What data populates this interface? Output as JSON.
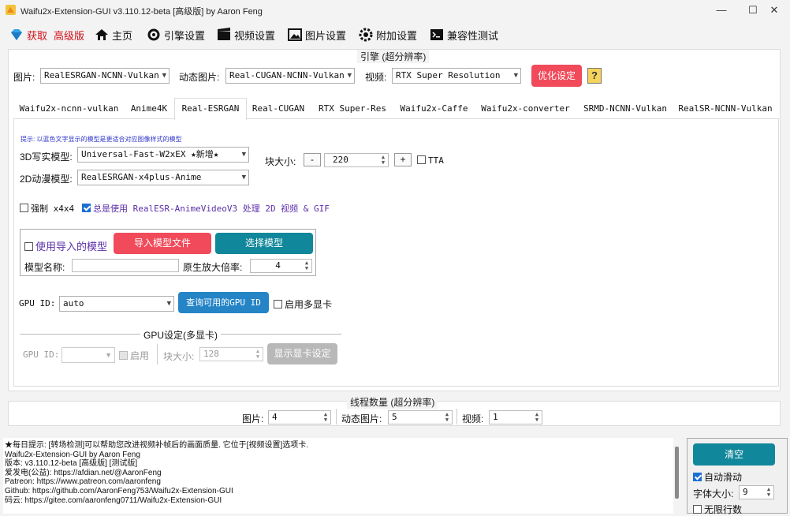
{
  "window": {
    "title": "Waifu2x-Extension-GUI v3.110.12-beta [高级版] by Aaron Feng"
  },
  "menu": {
    "get_label": "获取",
    "premium_label": "高级版",
    "home": "主页",
    "engine": "引擎设置",
    "video": "视频设置",
    "image": "图片设置",
    "extra": "附加设置",
    "compat": "兼容性测试"
  },
  "engine_group": {
    "title": "引擎 (超分辨率)",
    "image_label": "图片:",
    "image_engine": "RealESRGAN-NCNN-Vulkan",
    "gif_label": "动态图片:",
    "gif_engine": "Real-CUGAN-NCNN-Vulkan",
    "video_label": "视频:",
    "video_engine": "RTX Super Resolution",
    "optimize_button": "优化设定",
    "help_icon": "?"
  },
  "tabs": [
    "Waifu2x-ncnn-vulkan",
    "Anime4K",
    "Real-ESRGAN",
    "Real-CUGAN",
    "RTX Super-Res",
    "Waifu2x-Caffe",
    "Waifu2x-converter",
    "SRMD-NCNN-Vulkan",
    "RealSR-NCNN-Vulkan"
  ],
  "realesrgan": {
    "hint": "提示: 以蓝色文字显示的模型是更适合对应图像样式的模型",
    "model3d_label": "3D写实模型:",
    "model3d_value": "Universal-Fast-W2xEX ★新增★",
    "model2d_label": "2D动漫模型:",
    "model2d_value": "RealESRGAN-x4plus-Anime",
    "tile_label": "块大小:",
    "tile_minus": "-",
    "tile_value": "220",
    "tile_plus": "+",
    "tta_label": "TTA",
    "force_label": "强制 x4x4",
    "always_label": "总是使用 RealESR-AnimeVideoV3 处理 2D 视频 & GIF",
    "use_imported_label": "使用导入的模型",
    "import_button": "导入模型文件",
    "select_button": "选择模型",
    "model_name_label": "模型名称:",
    "model_name_value": "",
    "native_scale_label": "原生放大倍率:",
    "native_scale_value": "4",
    "gpu_label": "GPU ID:",
    "gpu_value": "auto",
    "query_gpu_button": "查询可用的GPU ID",
    "multi_gpu_label": "启用多显卡",
    "multi_gpu_group": "GPU设定(多显卡)",
    "mg_gpu_label": "GPU ID:",
    "mg_enable_label": "启用",
    "mg_tile_label": "块大小:",
    "mg_tile_value": "128",
    "mg_show_button": "显示显卡设定"
  },
  "threads": {
    "title": "线程数量 (超分辨率)",
    "image_label": "图片:",
    "image_value": "4",
    "gif_label": "动态图片:",
    "gif_value": "5",
    "video_label": "视频:",
    "video_value": "1"
  },
  "log": {
    "lines": [
      "★每日提示: [转场检测]可以帮助您改进视频补帧后的画面质量. 它位于[视频设置]选项卡.",
      "Waifu2x-Extension-GUI by Aaron Feng",
      "版本: v3.110.12-beta [高级版] [测试版]",
      "爱发电(公益): https://afdian.net/@AaronFeng",
      "Patreon: https://www.patreon.com/aaronfeng",
      "Github: https://github.com/AaronFeng753/Waifu2x-Extension-GUI",
      "码云: https://gitee.com/aaronfeng0711/Waifu2x-Extension-GUI"
    ]
  },
  "side": {
    "clear_button": "清空",
    "autoscroll_label": "自动滑动",
    "font_size_label": "字体大小:",
    "font_size_value": "9",
    "unlimited_label": "无限行数"
  },
  "colors": {
    "red_button": "#f14a5a",
    "teal_button": "#10879a",
    "blue_button": "#2484c6",
    "hint_blue": "#2f35c8"
  }
}
